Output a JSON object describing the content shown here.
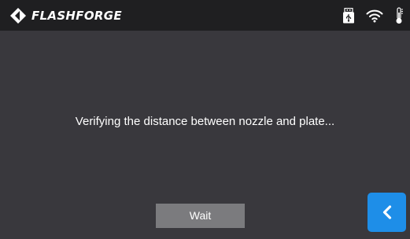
{
  "header": {
    "brand": "FLASHFORGE",
    "logo_icon": "flashforge-diamond-logo-icon",
    "status_icons": [
      "usb-drive-icon",
      "wifi-icon",
      "thermometer-icon"
    ]
  },
  "main": {
    "message": "Verifying the distance between nozzle and plate..."
  },
  "controls": {
    "wait_label": "Wait",
    "back_icon": "chevron-left-icon"
  },
  "colors": {
    "background": "#39383d",
    "topbar": "#1f1f21",
    "wait_button": "#7b7b7e",
    "back_button": "#1e8ee8"
  }
}
